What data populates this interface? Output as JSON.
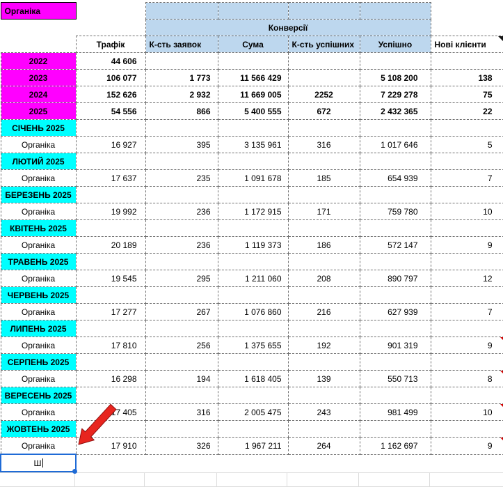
{
  "corner_label": "Органіка",
  "conversions_label": "Конверсії",
  "columns": [
    "Трафік",
    "К-сть заявок",
    "Сума",
    "К-сть успішних",
    "Успішно",
    "Нові клієнти"
  ],
  "years": [
    {
      "label": "2022",
      "values": [
        "44 606",
        "",
        "",
        "",
        "",
        ""
      ]
    },
    {
      "label": "2023",
      "values": [
        "106 077",
        "1 773",
        "11 566 429",
        "",
        "5 108 200",
        "138"
      ]
    },
    {
      "label": "2024",
      "values": [
        "152 626",
        "2 932",
        "11 669 005",
        "2252",
        "7 229 278",
        "75"
      ]
    },
    {
      "label": "2025",
      "values": [
        "54 556",
        "866",
        "5 400 555",
        "672",
        "2 432 365",
        "22"
      ]
    }
  ],
  "months": [
    {
      "header": "СІЧЕНЬ 2025",
      "label": "Органіка",
      "values": [
        "16 927",
        "395",
        "3 135 961",
        "316",
        "1 017 646",
        "5"
      ],
      "comment": false
    },
    {
      "header": "ЛЮТИЙ 2025",
      "label": "Органіка",
      "values": [
        "17 637",
        "235",
        "1 091 678",
        "185",
        "654 939",
        "7"
      ],
      "comment": false
    },
    {
      "header": "БЕРЕЗЕНЬ 2025",
      "label": "Органіка",
      "values": [
        "19 992",
        "236",
        "1 172 915",
        "171",
        "759 780",
        "10"
      ],
      "comment": false
    },
    {
      "header": "КВІТЕНЬ 2025",
      "label": "Органіка",
      "values": [
        "20 189",
        "236",
        "1 119 373",
        "186",
        "572 147",
        "9"
      ],
      "comment": false
    },
    {
      "header": "ТРАВЕНЬ 2025",
      "label": "Органіка",
      "values": [
        "19 545",
        "295",
        "1 211 060",
        "208",
        "890 797",
        "12"
      ],
      "comment": false
    },
    {
      "header": "ЧЕРВЕНЬ 2025",
      "label": "Органіка",
      "values": [
        "17 277",
        "267",
        "1 076 860",
        "216",
        "627 939",
        "7"
      ],
      "comment": false
    },
    {
      "header": "ЛИПЕНЬ 2025",
      "label": "Органіка",
      "values": [
        "17 810",
        "256",
        "1 375 655",
        "192",
        "901 319",
        "9"
      ],
      "comment": true
    },
    {
      "header": "СЕРПЕНЬ 2025",
      "label": "Органіка",
      "values": [
        "16 298",
        "194",
        "1 618 405",
        "139",
        "550 713",
        "8"
      ],
      "comment": true
    },
    {
      "header": "ВЕРЕСЕНЬ 2025",
      "label": "Органіка",
      "values": [
        "17 405",
        "316",
        "2 005 475",
        "243",
        "981 499",
        "10"
      ],
      "comment": true
    },
    {
      "header": "ЖОВТЕНЬ 2025",
      "label": "Органіка",
      "values": [
        "17 910",
        "326",
        "1 967 211",
        "264",
        "1 162 697",
        "9"
      ],
      "comment": true
    }
  ],
  "edit": {
    "text": "Ш"
  },
  "colors": {
    "magenta": "#FF00FF",
    "cyan": "#00FFFF",
    "header_blue": "#BDD7EE",
    "selection_blue": "#1F6BD6",
    "comment_red": "#D00000",
    "arrow_red": "#E8251F"
  }
}
